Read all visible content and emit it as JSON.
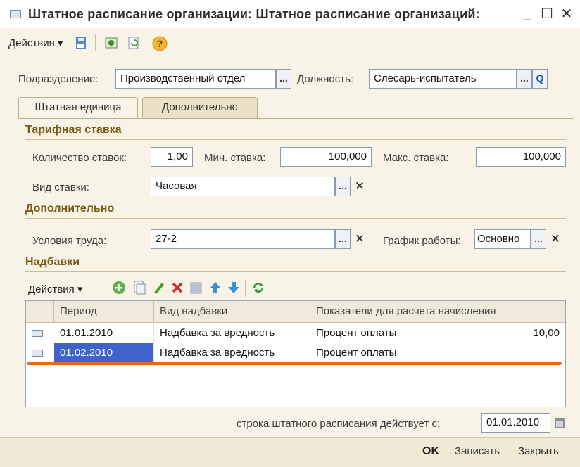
{
  "window": {
    "title": "Штатное расписание организации: Штатное расписание организаций:",
    "minimize": "_",
    "maximize": "☐",
    "close": "✕"
  },
  "toolbar": {
    "actions_label": "Действия ▾",
    "icons": [
      "save-icon",
      "view-icon",
      "refresh-icon",
      "help-icon"
    ],
    "help_glyph": "?"
  },
  "form": {
    "department_label": "Подразделение:",
    "department_value": "Производственный отдел",
    "position_label": "Должность:",
    "position_value": "Слесарь-испытатель",
    "ellipsis": "...",
    "search_glyph": "Q",
    "clear_glyph": "✕"
  },
  "tabs": [
    {
      "label": "Штатная единица",
      "active": true
    },
    {
      "label": "Дополнительно",
      "active": false
    }
  ],
  "tariff": {
    "section": "Тарифная ставка",
    "count_label": "Количество ставок:",
    "count_value": "1,00",
    "min_label": "Мин. ставка:",
    "min_value": "100,000",
    "max_label": "Макс. ставка:",
    "max_value": "100,000",
    "type_label": "Вид ставки:",
    "type_value": "Часовая"
  },
  "additional": {
    "section": "Дополнительно",
    "conditions_label": "Условия труда:",
    "conditions_value": "27-2",
    "schedule_label": "График работы:",
    "schedule_value": "Основно"
  },
  "bonuses": {
    "section": "Надбавки",
    "actions_label": "Действия ▾",
    "columns": [
      "Период",
      "Вид надбавки",
      "Показатели для расчета начисления"
    ],
    "rows": [
      {
        "period": "01.01.2010",
        "type": "Надбавка за вредность",
        "indicator": "Процент оплаты",
        "value": "10,00",
        "selected": false
      },
      {
        "period": "01.02.2010",
        "type": "Надбавка за вредность",
        "indicator": "Процент оплаты",
        "value": "",
        "selected": true
      }
    ]
  },
  "validity": {
    "label": "строка штатного расписания действует с:",
    "date": "01.01.2010"
  },
  "footer": {
    "ok": "OK",
    "save": "Записать",
    "close": "Закрыть"
  },
  "colors": {
    "accent_section": "#7b5a12",
    "selection": "#3f63c8",
    "highlight_line": "#e06a2a"
  }
}
